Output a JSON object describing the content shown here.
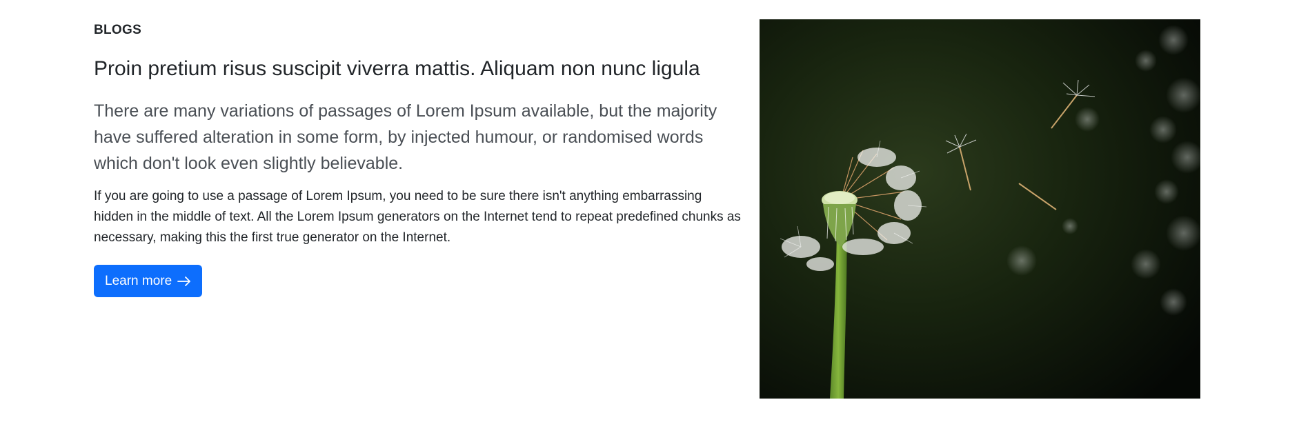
{
  "section": {
    "eyebrow": "BLOGS",
    "headline": "Proin pretium risus suscipit viverra mattis. Aliquam non nunc ligula",
    "lead": "There are many variations of passages of Lorem Ipsum available, but the majority have suffered alteration in some form, by injected humour, or randomised words which don't look even slightly believable.",
    "body": "If you are going to use a passage of Lorem Ipsum, you need to be sure there isn't anything embarrassing hidden in the middle of text. All the Lorem Ipsum generators on the Internet tend to repeat predefined chunks as necessary, making this the first true generator on the Internet.",
    "cta_label": "Learn more",
    "cta_icon": "arrow-right-icon"
  },
  "image": {
    "subject": "dandelion-photo"
  },
  "colors": {
    "primary": "#0d6efd",
    "text": "#212529",
    "muted": "#4a4f55"
  }
}
